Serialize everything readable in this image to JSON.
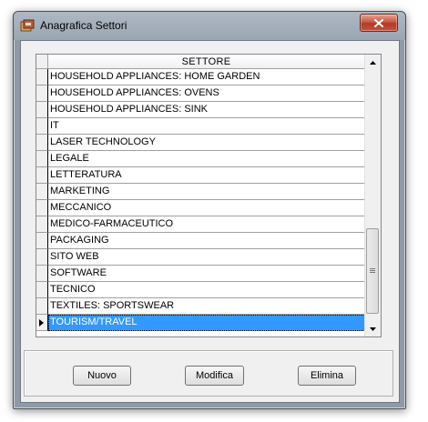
{
  "window": {
    "title": "Anagrafica Settori"
  },
  "grid": {
    "column_header": "SETTORE",
    "rows": [
      "HOUSEHOLD APPLIANCES: HOME GARDEN",
      "HOUSEHOLD APPLIANCES: OVENS",
      "HOUSEHOLD APPLIANCES: SINK",
      "IT",
      "LASER TECHNOLOGY",
      "LEGALE",
      "LETTERATURA",
      "MARKETING",
      "MECCANICO",
      "MEDICO-FARMACEUTICO",
      "PACKAGING",
      "SITO WEB",
      "SOFTWARE",
      "TECNICO",
      "TEXTILES: SPORTSWEAR",
      "TOURISM/TRAVEL"
    ],
    "selected_row": 15
  },
  "buttons": {
    "new_label": "Nuovo",
    "edit_label": "Modifica",
    "delete_label": "Elimina"
  },
  "colors": {
    "selection": "#3399ff",
    "close_button": "#c75a45"
  },
  "icons": {
    "app": "app-icon",
    "close": "close-icon",
    "scroll_up": "scroll-up-icon",
    "scroll_down": "scroll-down-icon",
    "row_pointer": "row-pointer-icon"
  }
}
